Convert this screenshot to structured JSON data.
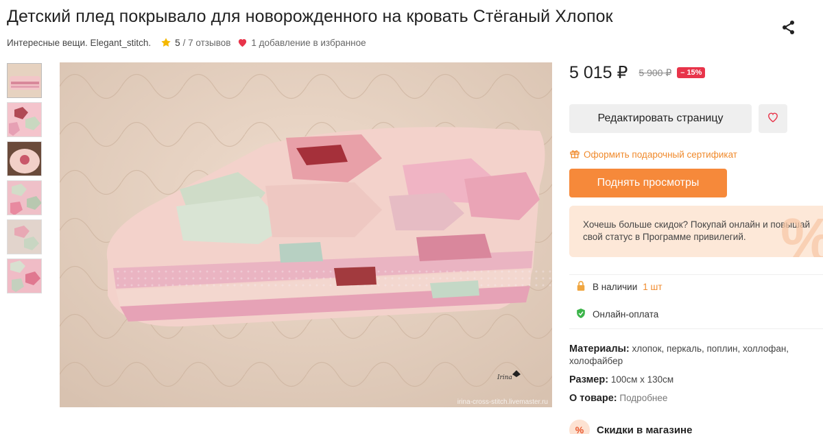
{
  "product": {
    "title": "Детский плед покрывало для новорожденного на кровать Стёганый Хлопок",
    "shop": "Интересные вещи. Elegant_stitch.",
    "rating": "5",
    "reviews": "/ 7 отзывов",
    "favorites": "1 добавление в избранное",
    "watermark": "irina-cross-stitch.livemaster.ru"
  },
  "pricing": {
    "price": "5 015 ₽",
    "old_price": "5 900 ₽",
    "discount": "– 15%"
  },
  "actions": {
    "edit_label": "Редактировать страницу",
    "gift_label": "Оформить подарочный сертификат",
    "boost_label": "Поднять просмотры"
  },
  "promo": {
    "text": "Хочешь больше скидок? Покупай онлайн и повышай свой статус в Программе привилегий.",
    "symbol": "%"
  },
  "availability": {
    "stock_label": "В наличии",
    "stock_qty": "1 шт",
    "payment_label": "Онлайн-оплата"
  },
  "specs": {
    "materials_label": "Материалы:",
    "materials_value": "хлопок, перкаль, поплин, холлофан, холофайбер",
    "size_label": "Размер:",
    "size_value": "100см х 130см",
    "about_label": "О товаре:",
    "about_value": "Подробнее"
  },
  "store_discounts": {
    "icon": "%",
    "label": "Скидки в магазине"
  },
  "colors": {
    "accent_orange": "#f6893a",
    "badge_red": "#e8344a",
    "heart_red": "#e8344a",
    "promo_bg": "#fde8d8",
    "star_yellow": "#f5b800",
    "shield_green": "#3cb44a"
  },
  "icons": [
    "share-icon",
    "star-icon",
    "heart-icon",
    "gift-icon",
    "lock-icon",
    "shield-check-icon",
    "percent-icon"
  ]
}
